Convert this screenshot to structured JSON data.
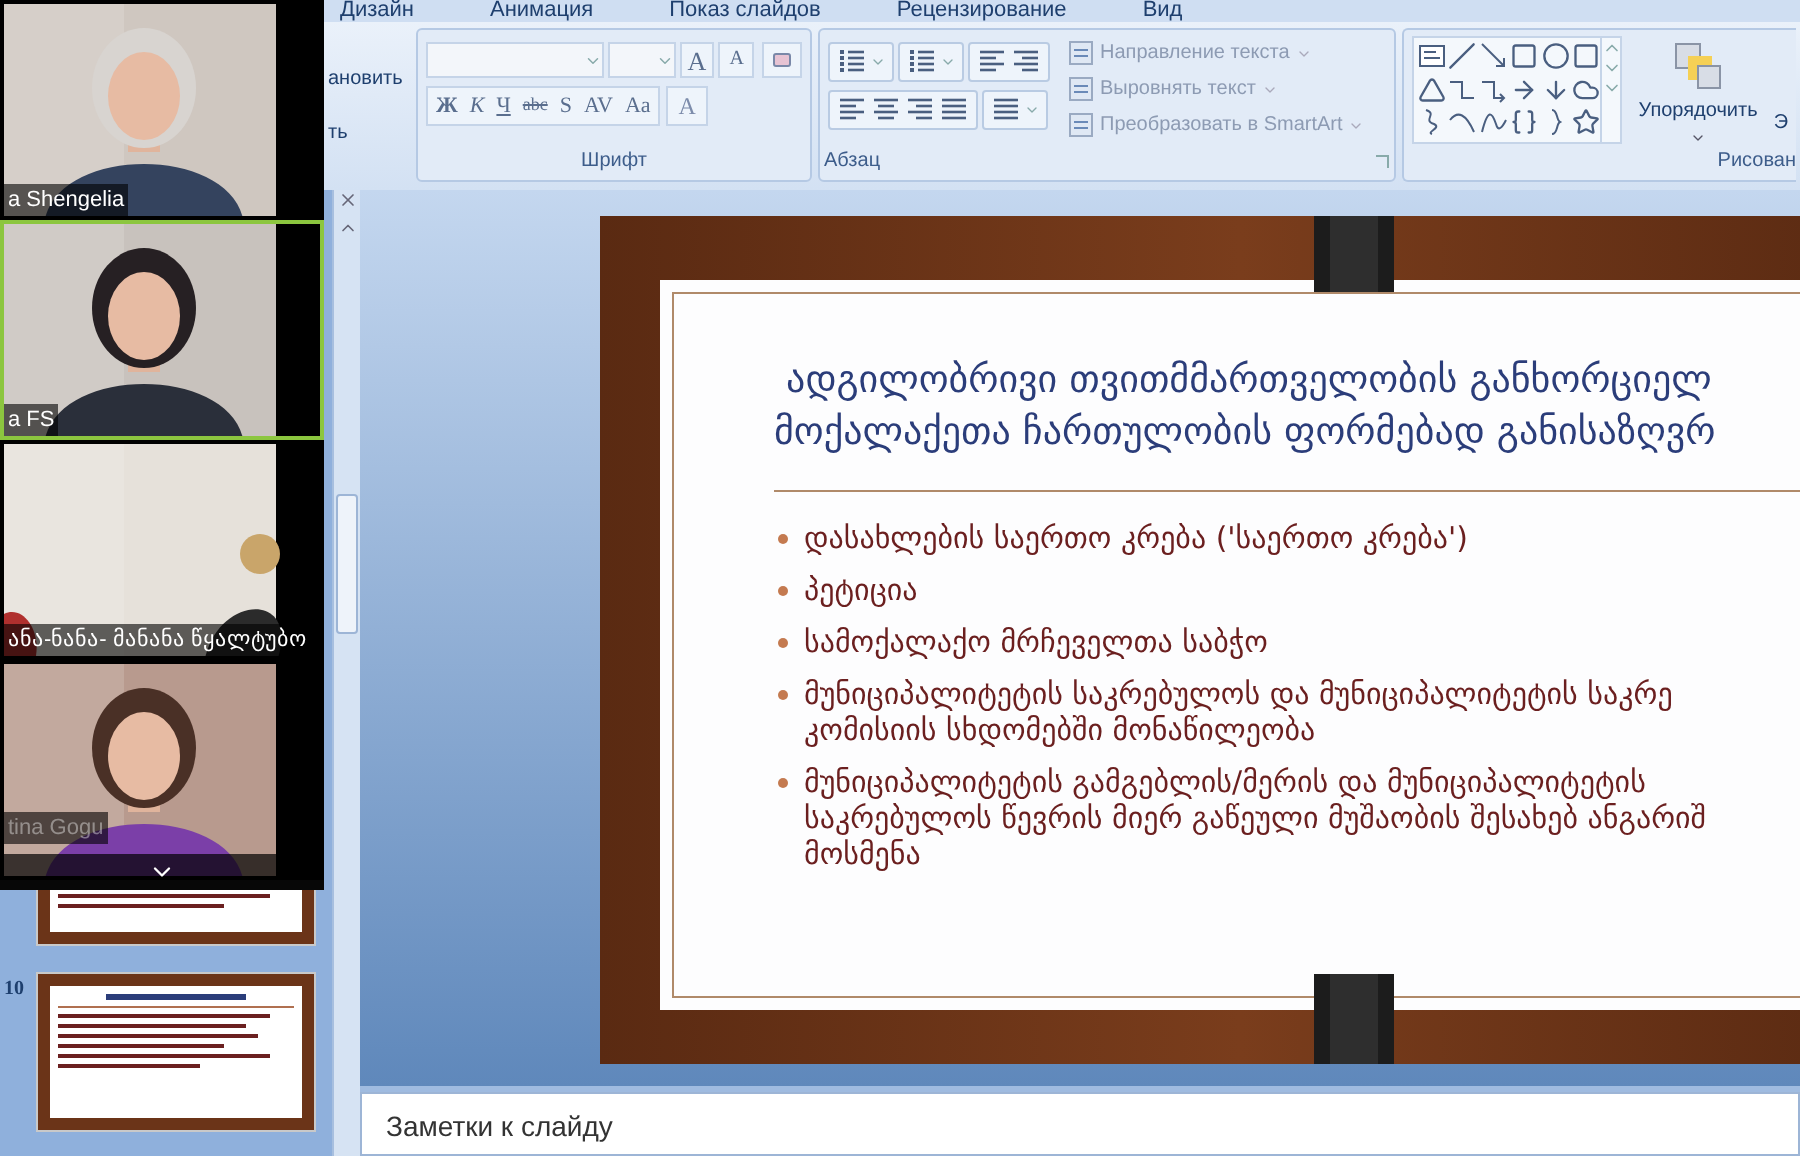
{
  "ribbon": {
    "tabs": [
      {
        "label": "Дизайн",
        "selected": false
      },
      {
        "label": "Анимация",
        "selected": false
      },
      {
        "label": "Показ слайдов",
        "selected": false
      },
      {
        "label": "Рецензирование",
        "selected": false
      },
      {
        "label": "Вид",
        "selected": false
      }
    ],
    "clipboard_group": {
      "items": [
        "ановить",
        "ть"
      ]
    },
    "font_group": {
      "title": "Шрифт",
      "grow_buttons": [
        "A",
        "A"
      ],
      "format_buttons": [
        "Ж",
        "К",
        "Ч",
        "abc",
        "S",
        "AV",
        "Aa"
      ],
      "font_color": "A"
    },
    "paragraph_group": {
      "title": "Абзац",
      "commands": [
        "Направление текста",
        "Выровнять текст",
        "Преобразовать в SmartArt"
      ]
    },
    "drawing_group": {
      "title": "Рисован",
      "arrange": "Упорядочить",
      "quick_styles": "Э"
    }
  },
  "video_panel": {
    "participants": [
      {
        "name": "a Shengelia",
        "active_speaker": false
      },
      {
        "name": "a FS",
        "active_speaker": true
      },
      {
        "name": "ანა-ნანა- მანანა წყალტუბო",
        "active_speaker": false
      },
      {
        "name": "tina Gogu",
        "active_speaker": false
      }
    ]
  },
  "slide_panel": {
    "thumbnail_number": "10"
  },
  "slide": {
    "title_lines": [
      " ადგილობრივი თვითმმართველობის განხორციელ",
      "მოქალაქეთა ჩართულობის ფორმებად განისაზღვრ"
    ],
    "bullets": [
      {
        "lines": [
          "დასახლების საერთო კრება ('საერთო კრება')"
        ]
      },
      {
        "lines": [
          "პეტიცია"
        ]
      },
      {
        "lines": [
          "სამოქალაქო მრჩეველთა საბჭო"
        ]
      },
      {
        "lines": [
          "მუნიციპალიტეტის საკრებულოს და მუნიციპალიტეტის საკრე",
          "კომისიის სხდომებში მონაწილეობა"
        ]
      },
      {
        "lines": [
          "მუნიციპალიტეტის გამგებლის/მერის და მუნიციპალიტეტის",
          "საკრებულოს წევრის მიერ გაწეული მუშაობის შესახებ ანგარიშ",
          "მოსმენა"
        ]
      }
    ]
  },
  "notes": {
    "placeholder": "Заметки к слайду"
  }
}
